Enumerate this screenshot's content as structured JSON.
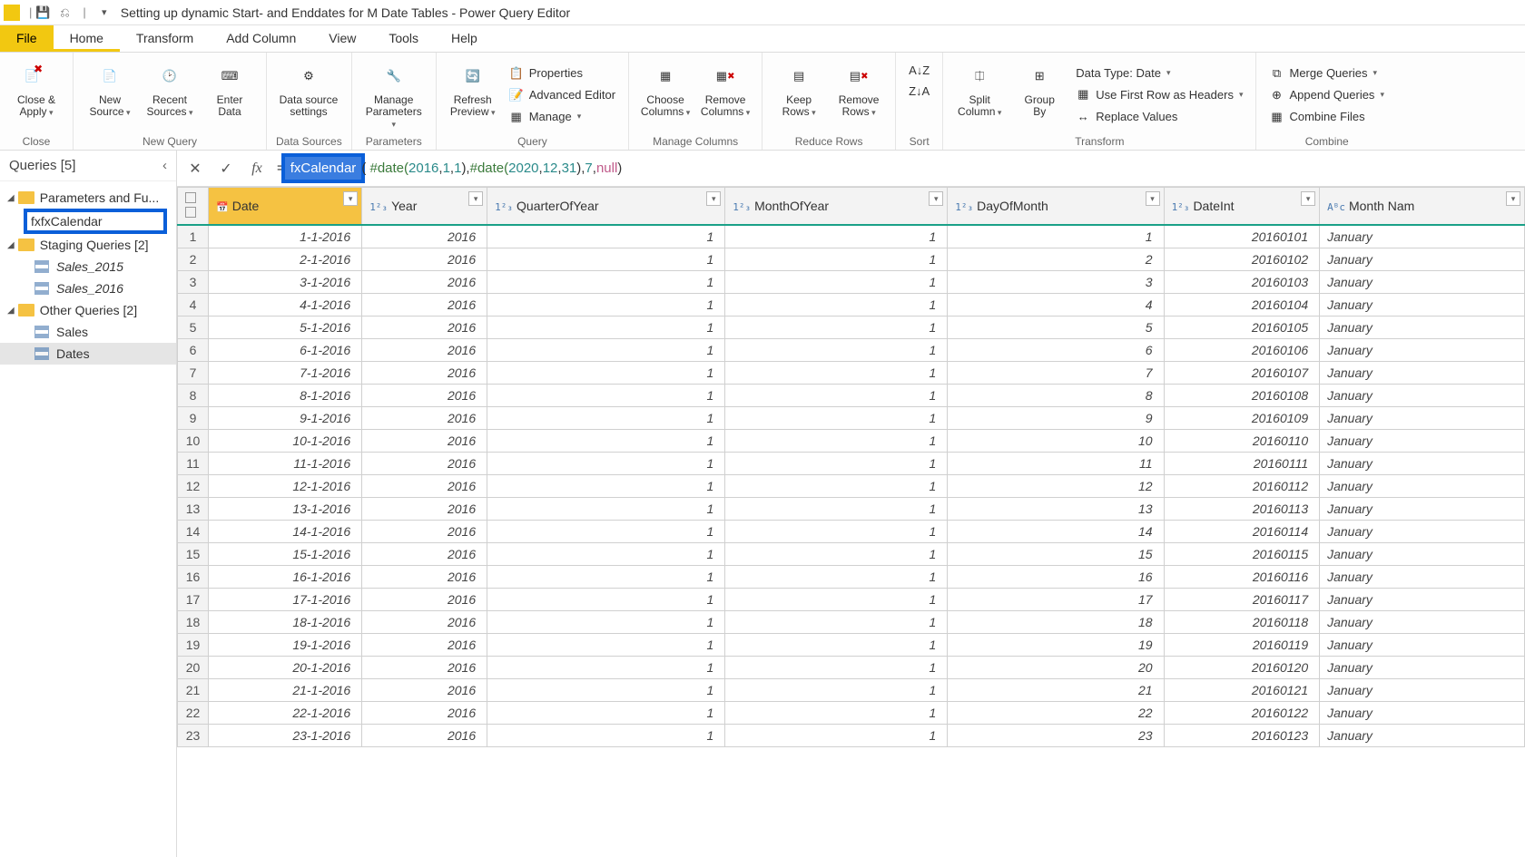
{
  "title": "Setting up dynamic Start- and Enddates for M Date Tables - Power Query Editor",
  "tabs": {
    "file": "File",
    "home": "Home",
    "transform": "Transform",
    "addcol": "Add Column",
    "view": "View",
    "tools": "Tools",
    "help": "Help"
  },
  "ribbon": {
    "close_apply": "Close &\nApply",
    "close_group": "Close",
    "new_source": "New\nSource",
    "recent_sources": "Recent\nSources",
    "enter_data": "Enter\nData",
    "new_query_group": "New Query",
    "data_source_settings": "Data source\nsettings",
    "data_sources_group": "Data Sources",
    "manage_parameters": "Manage\nParameters",
    "parameters_group": "Parameters",
    "refresh_preview": "Refresh\nPreview",
    "properties": "Properties",
    "advanced_editor": "Advanced Editor",
    "manage": "Manage",
    "query_group": "Query",
    "choose_columns": "Choose\nColumns",
    "remove_columns": "Remove\nColumns",
    "manage_columns_group": "Manage Columns",
    "keep_rows": "Keep\nRows",
    "remove_rows": "Remove\nRows",
    "reduce_rows_group": "Reduce Rows",
    "sort_group": "Sort",
    "split_column": "Split\nColumn",
    "group_by": "Group\nBy",
    "data_type": "Data Type: Date",
    "first_row_headers": "Use First Row as Headers",
    "replace_values": "Replace Values",
    "transform_group": "Transform",
    "merge_queries": "Merge Queries",
    "append_queries": "Append Queries",
    "combine_files": "Combine Files",
    "combine_group": "Combine"
  },
  "queries": {
    "header": "Queries [5]",
    "group1": "Parameters and Fu...",
    "fxcal": "fxCalendar",
    "group2": "Staging Queries [2]",
    "sales2015": "Sales_2015",
    "sales2016": "Sales_2016",
    "group3": "Other Queries [2]",
    "sales": "Sales",
    "dates": "Dates"
  },
  "formula": {
    "fnname": "fxCalendar",
    "p1": "#date(",
    "n1": "2016",
    "c": ", ",
    "n2": "1",
    "n3": "1",
    "pe": "), ",
    "p2": "#date( ",
    "n4": "2020",
    "n5": "12",
    "n6": "31",
    "pe2": "), ",
    "n7": "7",
    "c2": ", ",
    "nul": "null",
    "end": ")"
  },
  "columns": [
    "Date",
    "Year",
    "QuarterOfYear",
    "MonthOfYear",
    "DayOfMonth",
    "DateInt",
    "Month Nam"
  ],
  "coltypes": [
    "📅",
    "1²₃",
    "1²₃",
    "1²₃",
    "1²₃",
    "1²₃",
    "Aᴮc"
  ],
  "rows": [
    [
      "1-1-2016",
      "2016",
      "1",
      "1",
      "1",
      "20160101",
      "January"
    ],
    [
      "2-1-2016",
      "2016",
      "1",
      "1",
      "2",
      "20160102",
      "January"
    ],
    [
      "3-1-2016",
      "2016",
      "1",
      "1",
      "3",
      "20160103",
      "January"
    ],
    [
      "4-1-2016",
      "2016",
      "1",
      "1",
      "4",
      "20160104",
      "January"
    ],
    [
      "5-1-2016",
      "2016",
      "1",
      "1",
      "5",
      "20160105",
      "January"
    ],
    [
      "6-1-2016",
      "2016",
      "1",
      "1",
      "6",
      "20160106",
      "January"
    ],
    [
      "7-1-2016",
      "2016",
      "1",
      "1",
      "7",
      "20160107",
      "January"
    ],
    [
      "8-1-2016",
      "2016",
      "1",
      "1",
      "8",
      "20160108",
      "January"
    ],
    [
      "9-1-2016",
      "2016",
      "1",
      "1",
      "9",
      "20160109",
      "January"
    ],
    [
      "10-1-2016",
      "2016",
      "1",
      "1",
      "10",
      "20160110",
      "January"
    ],
    [
      "11-1-2016",
      "2016",
      "1",
      "1",
      "11",
      "20160111",
      "January"
    ],
    [
      "12-1-2016",
      "2016",
      "1",
      "1",
      "12",
      "20160112",
      "January"
    ],
    [
      "13-1-2016",
      "2016",
      "1",
      "1",
      "13",
      "20160113",
      "January"
    ],
    [
      "14-1-2016",
      "2016",
      "1",
      "1",
      "14",
      "20160114",
      "January"
    ],
    [
      "15-1-2016",
      "2016",
      "1",
      "1",
      "15",
      "20160115",
      "January"
    ],
    [
      "16-1-2016",
      "2016",
      "1",
      "1",
      "16",
      "20160116",
      "January"
    ],
    [
      "17-1-2016",
      "2016",
      "1",
      "1",
      "17",
      "20160117",
      "January"
    ],
    [
      "18-1-2016",
      "2016",
      "1",
      "1",
      "18",
      "20160118",
      "January"
    ],
    [
      "19-1-2016",
      "2016",
      "1",
      "1",
      "19",
      "20160119",
      "January"
    ],
    [
      "20-1-2016",
      "2016",
      "1",
      "1",
      "20",
      "20160120",
      "January"
    ],
    [
      "21-1-2016",
      "2016",
      "1",
      "1",
      "21",
      "20160121",
      "January"
    ],
    [
      "22-1-2016",
      "2016",
      "1",
      "1",
      "22",
      "20160122",
      "January"
    ],
    [
      "23-1-2016",
      "2016",
      "1",
      "1",
      "23",
      "20160123",
      "January"
    ]
  ]
}
